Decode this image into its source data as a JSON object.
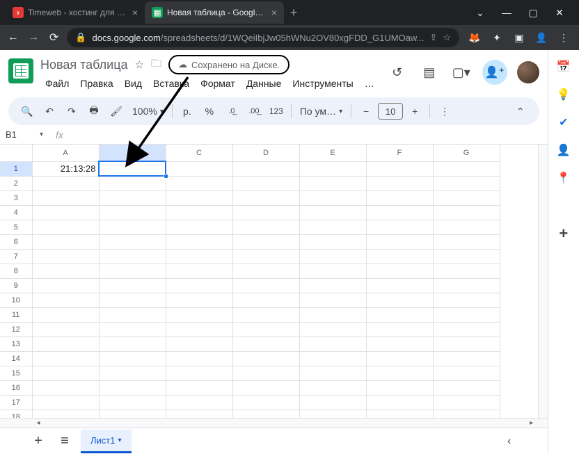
{
  "browser": {
    "tabs": [
      {
        "title": "Timeweb - хостинг для сайтов",
        "favicon_bg": "#e53935",
        "favicon_glyph": "›"
      },
      {
        "title": "Новая таблица - Google Таблицы",
        "favicon_bg": "#0f9d58",
        "favicon_glyph": "▦"
      }
    ],
    "url_prefix": "docs.google.com",
    "url_path": "/spreadsheets/d/1WQeiIbjJw05hWNu2OV80xgFDD_G1UMOaw..."
  },
  "sheets": {
    "doc_title": "Новая таблица",
    "save_status": "Сохранено на Диске.",
    "menus": [
      "Файл",
      "Правка",
      "Вид",
      "Вставка",
      "Формат",
      "Данные",
      "Инструменты",
      "…"
    ],
    "toolbar": {
      "zoom": "100%",
      "currency_glyph": "р.",
      "percent_glyph": "%",
      "dec_down": ".0←",
      "dec_up": ".00→",
      "num_format": "123",
      "font_name": "По ум…",
      "font_size": "10"
    },
    "namebox": "B1",
    "fx": "fx",
    "columns": [
      "A",
      "B",
      "C",
      "D",
      "E",
      "F",
      "G"
    ],
    "selected_col_index": 1,
    "selected_row_index": 0,
    "rows": 19,
    "cells": {
      "A1": "21:13:28"
    },
    "active_sheet": "Лист1"
  },
  "sidepanel": {
    "items": [
      {
        "name": "calendar",
        "color": "#1a73e8",
        "glyph": "📅"
      },
      {
        "name": "keep",
        "color": "#fbbc04",
        "glyph": "🟡"
      },
      {
        "name": "tasks",
        "color": "#1a73e8",
        "glyph": "✓"
      },
      {
        "name": "contacts",
        "color": "#1a73e8",
        "glyph": "👤"
      },
      {
        "name": "maps",
        "color": "#34a853",
        "glyph": "📍"
      }
    ]
  }
}
